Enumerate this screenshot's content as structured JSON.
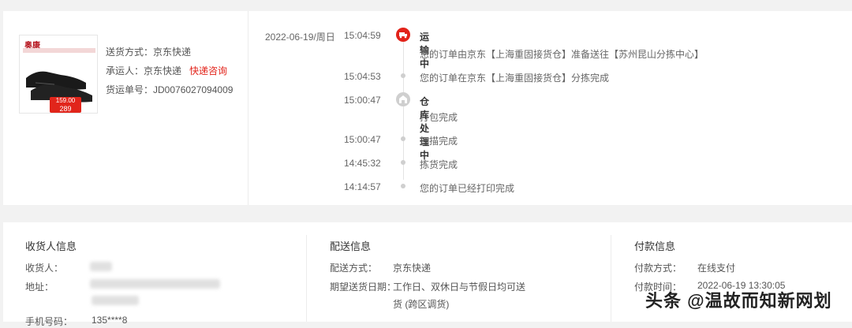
{
  "package": {
    "delivery_method": "送货方式：京东快递",
    "carrier_label": "承运人：京东快递",
    "carrier_link": "快递咨询",
    "tracking_number": "货运单号：JD0076027094009",
    "thumb_brand": "奥康",
    "thumb_price_top": "159.00",
    "thumb_price": "289"
  },
  "timeline": {
    "date": "2022-06-19/周日",
    "events": [
      {
        "time": "15:04:59",
        "title": "运输中",
        "text": "您的订单由京东【上海重固接货仓】准备送往【苏州昆山分拣中心】",
        "icon": "truck-icon"
      },
      {
        "time": "15:04:53",
        "title": "",
        "text": "您的订单在京东【上海重固接货仓】分拣完成"
      },
      {
        "time": "15:00:47",
        "title": "仓库处理中",
        "text": "打包完成",
        "icon": "warehouse-icon"
      },
      {
        "time": "15:00:47",
        "title": "",
        "text": "扫描完成"
      },
      {
        "time": "14:45:32",
        "title": "",
        "text": "拣货完成"
      },
      {
        "time": "14:14:57",
        "title": "",
        "text": "您的订单已经打印完成"
      }
    ]
  },
  "receiver": {
    "title": "收货人信息",
    "name_label": "收货人：",
    "address_label": "地址：",
    "phone_label": "手机号码：",
    "phone_value": "135****8"
  },
  "delivery": {
    "title": "配送信息",
    "method_label": "配送方式：",
    "method_value": "京东快递",
    "date_label": "期望送货日期：",
    "date_value_1": "工作日、双休日与节假日均可送",
    "date_value_2": "货 (跨区调货)"
  },
  "payment": {
    "title": "付款信息",
    "method_label": "付款方式：",
    "method_value": "在线支付",
    "time_label": "付款时间：",
    "time_value": "2022-06-19 13:30:05"
  },
  "watermark": "头条 @温故而知新网划",
  "colors": {
    "accent": "#e2231a",
    "background": "#f2f2f2"
  }
}
